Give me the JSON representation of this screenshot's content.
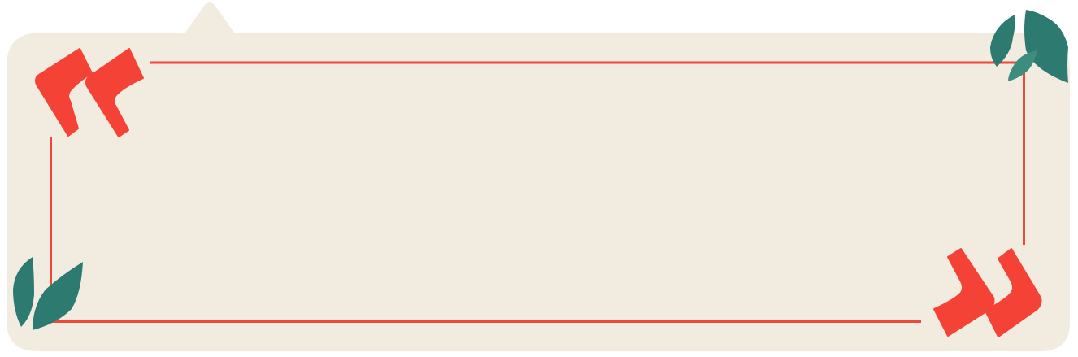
{
  "colors": {
    "background": "#ffffff",
    "card_fill": "#f2ebdf",
    "frame_line": "#f0473c",
    "quote_mark": "#f44336",
    "leaf_dark": "#2d7a70",
    "leaf_light": "#3d8c80"
  },
  "icons": {
    "open_quote": "opening-double-quote-icon",
    "close_quote": "closing-double-quote-icon",
    "leaves": "leaf-icon"
  },
  "text": {
    "body": ""
  }
}
